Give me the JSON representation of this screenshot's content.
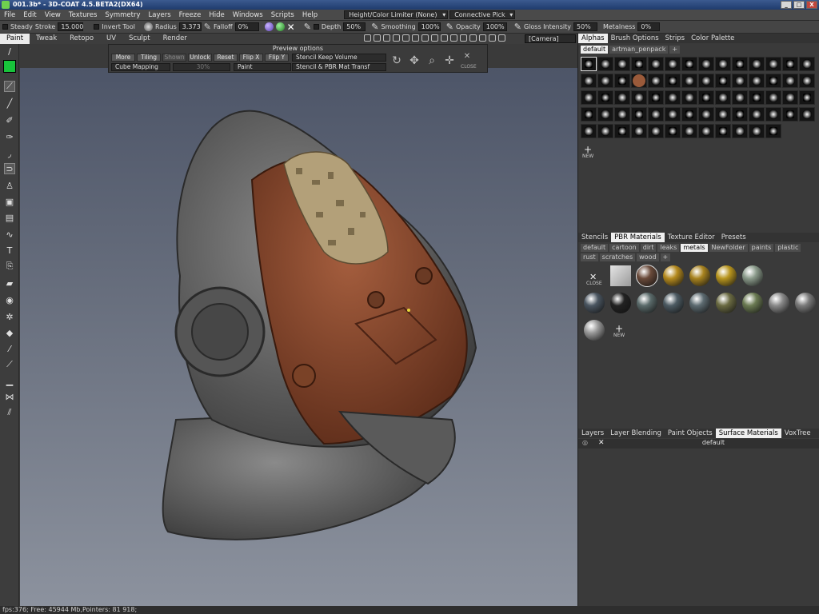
{
  "window": {
    "title": "001.3b* - 3D-COAT 4.5.BETA2(DX64)",
    "buttons": [
      "_",
      "□",
      "X"
    ]
  },
  "menu": {
    "items": [
      "File",
      "Edit",
      "View",
      "Textures",
      "Symmetry",
      "Layers",
      "Freeze",
      "Hide",
      "Windows",
      "Scripts",
      "Help"
    ],
    "limiter": "Height/Color Limiter (None)",
    "pick": "Connective Pick"
  },
  "options": {
    "steady": "Steady",
    "stroke_label": "Stroke",
    "stroke_value": "15.000",
    "invert_tool": "Invert Tool",
    "radius_label": "Radius",
    "radius_value": "3.373",
    "falloff_label": "Falloff",
    "falloff_value": "0%",
    "depth_label": "Depth",
    "depth_value": "50%",
    "smoothing_label": "Smoothing",
    "smoothing_value": "100%",
    "opacity_label": "Opacity",
    "opacity_value": "100%",
    "gloss_label": "Gloss Intensity",
    "gloss_value": "50%",
    "metalness_label": "Metalness",
    "metalness_value": "0%"
  },
  "rooms": {
    "tabs": [
      "Paint",
      "Tweak",
      "Retopo",
      "UV",
      "Sculpt",
      "Render"
    ],
    "active": "Paint",
    "camera": "[Camera]"
  },
  "preview": {
    "title": "Preview options",
    "more": "More",
    "tiling": "Tiling",
    "shown": "Shown",
    "unlock": "Unlock",
    "reset": "Reset",
    "flipx": "Flip X",
    "flipy": "Flip Y",
    "stencil_mode": "Stencil Keep Volume",
    "mapping": "Cube Mapping",
    "percent": "30%",
    "paint": "Paint",
    "stencil_pbr": "Stencil & PBR Mat Transf",
    "close": "CLOSE"
  },
  "alphas_panel": {
    "tabs": [
      "Alphas",
      "Brush Options",
      "Strips",
      "Color Palette"
    ],
    "active": "Alphas",
    "filters": [
      "default",
      "artman_penpack"
    ],
    "new_label": "NEW"
  },
  "materials_panel": {
    "tabs": [
      "Stencils",
      "PBR Materials",
      "Texture Editor",
      "Presets"
    ],
    "active": "PBR Materials",
    "filters": [
      "default",
      "cartoon",
      "dirt",
      "leaks",
      "metals",
      "NewFolder",
      "paints",
      "plastic",
      "rust",
      "scratches",
      "wood"
    ],
    "active_filter": "metals",
    "close_label": "CLOSE",
    "new_label": "NEW"
  },
  "layers_panel": {
    "tabs": [
      "Layers",
      "Layer Blending",
      "Paint Objects",
      "Surface Materials",
      "VoxTree"
    ],
    "active": "Surface Materials",
    "row_label": "default"
  },
  "status": {
    "text": "fps:376;    Free: 45944 Mb,Pointers: 81 918;"
  },
  "colors": {
    "primary_swatch": "#18c43b",
    "accent_rust": "#8b4a2e"
  }
}
